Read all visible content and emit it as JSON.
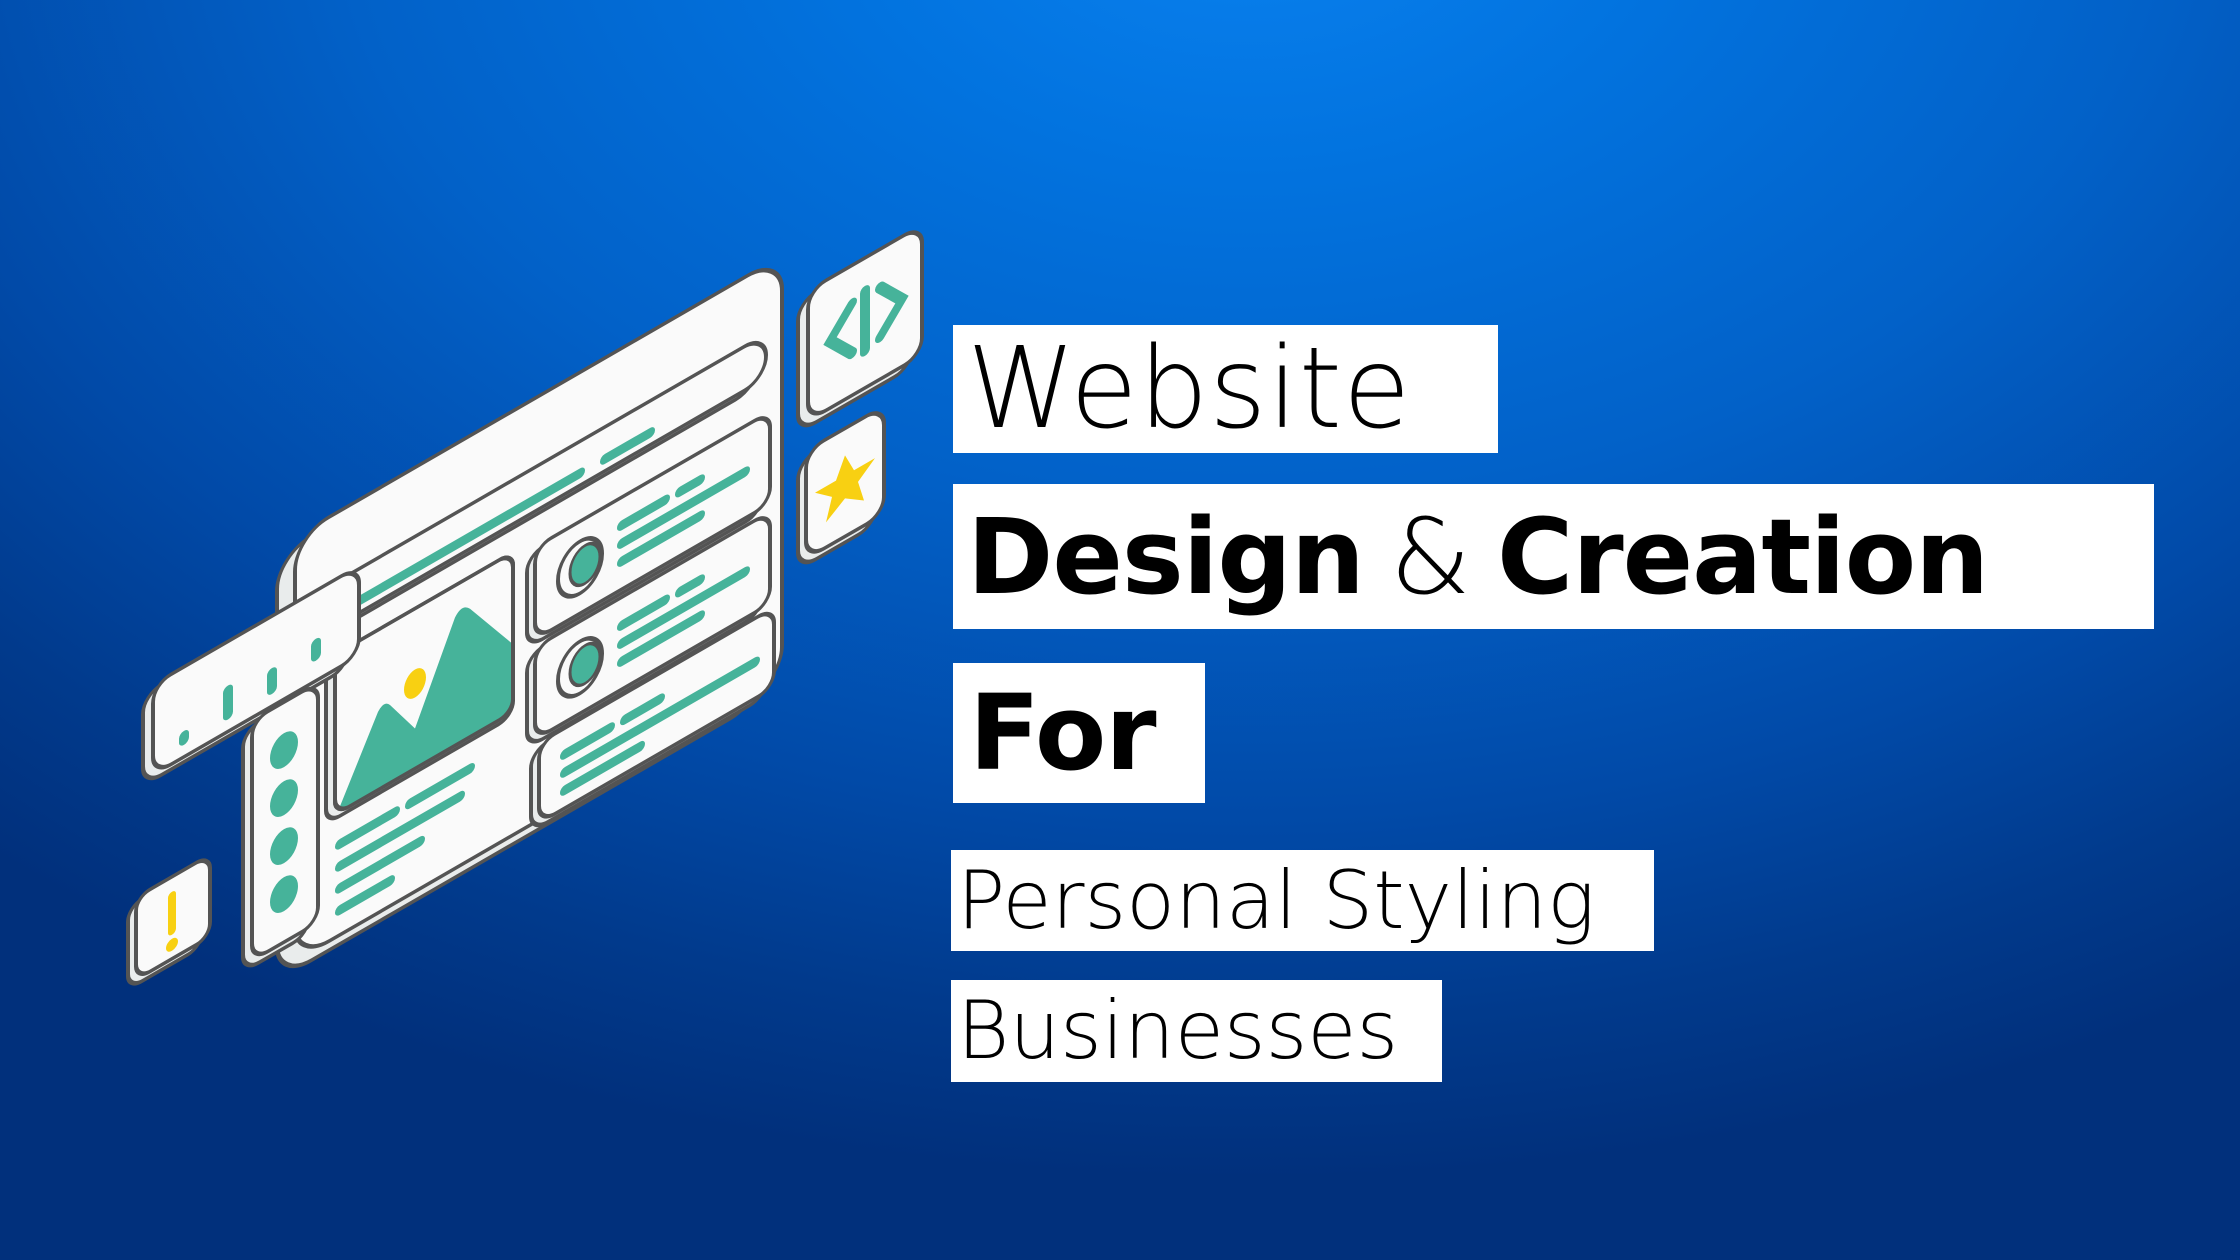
{
  "headline": {
    "line1": "Website",
    "line2_bold_a": "Design",
    "line2_amp": "&",
    "line2_bold_b": "Creation",
    "line3": "For",
    "line4": "Personal Styling",
    "line5": "Businesses"
  },
  "illustration": {
    "subject": "isometric website wireframe",
    "icons": [
      "browser-window-icon",
      "code-tag-icon",
      "star-icon",
      "exclamation-icon",
      "image-placeholder-icon",
      "bar-chart-widget-icon",
      "sidebar-dots-icon",
      "profile-card-icon"
    ],
    "code_glyph": "</>",
    "alert_glyph": "!"
  },
  "colors": {
    "background_top": "#0a82f0",
    "background_bottom": "#01307c",
    "label_background": "#ffffff",
    "label_text": "#000000",
    "accent_teal": "#46b39a",
    "accent_yellow": "#f8d012",
    "panel_fill": "#fafafa",
    "panel_side": "#e9ecec",
    "outline": "#545454"
  }
}
